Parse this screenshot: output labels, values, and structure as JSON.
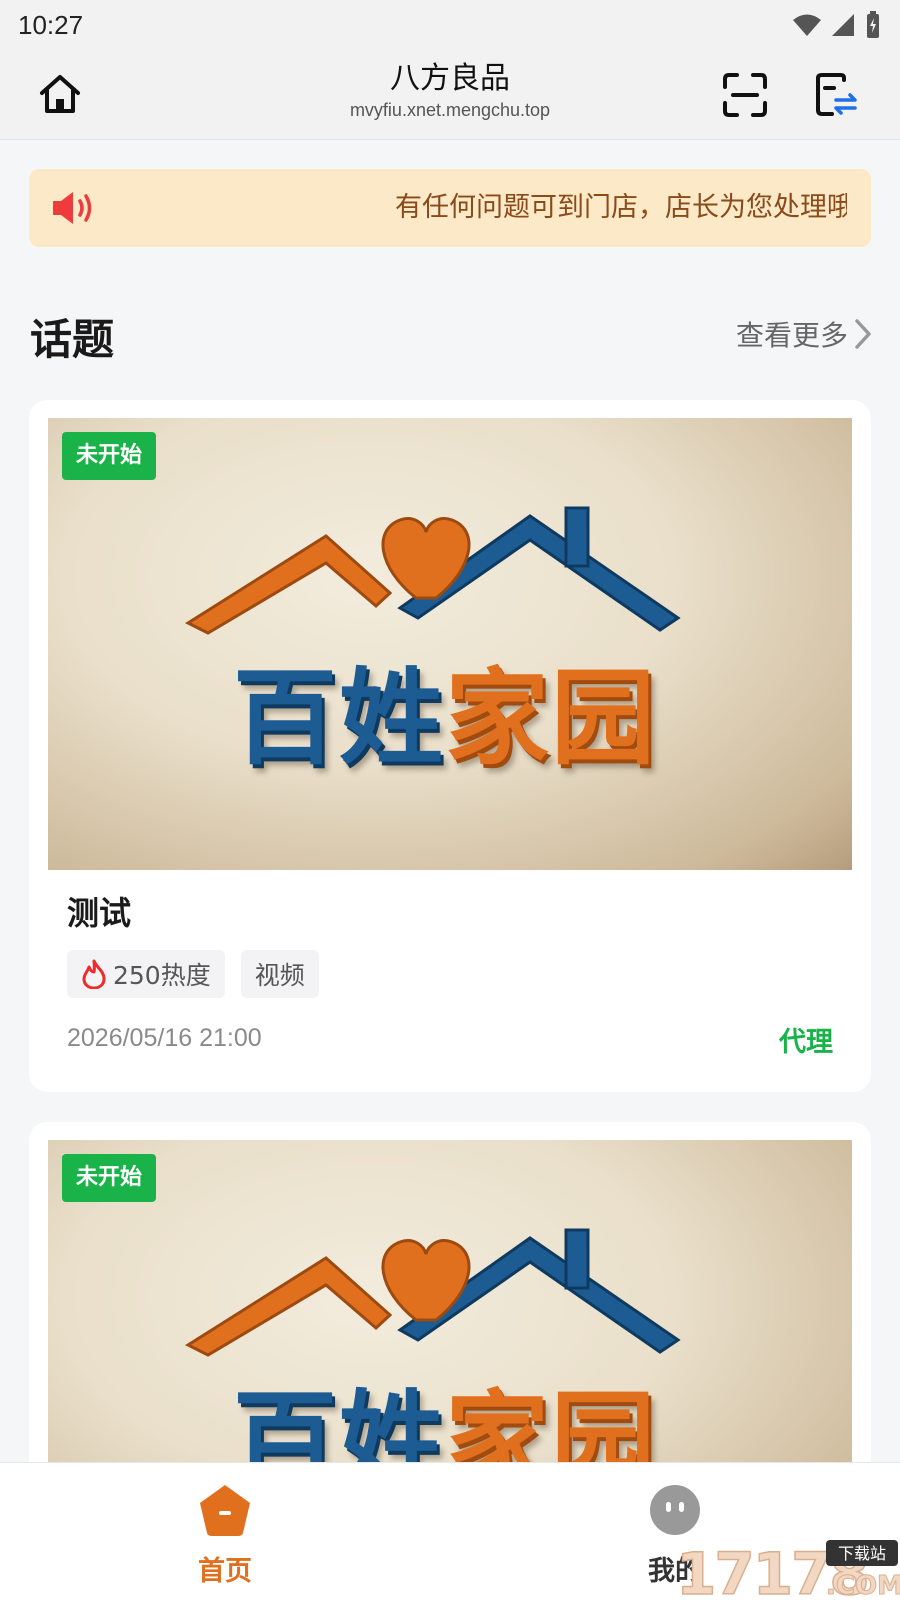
{
  "status_bar": {
    "time": "10:27"
  },
  "browser": {
    "title": "八方良品",
    "url": "mvyfiu.xnet.mengchu.top"
  },
  "notice": {
    "text": "有任何问题可到门店，店长为您处理哦"
  },
  "section": {
    "title": "话题",
    "see_more": "查看更多"
  },
  "cards": [
    {
      "badge": "未开始",
      "logo": {
        "part1": "百姓",
        "part2": "家",
        "part3": "园"
      },
      "title": "测试",
      "heat": "250热度",
      "tag": "视频",
      "date": "2026/05/16 21:00",
      "action": "代理"
    },
    {
      "badge": "未开始",
      "logo": {
        "part1": "百姓",
        "part2": "家",
        "part3": "园"
      }
    }
  ],
  "bottom_nav": {
    "items": [
      {
        "label": "首页",
        "icon": "home-icon",
        "active": true
      },
      {
        "label": "我的",
        "icon": "profile-icon",
        "active": false
      }
    ]
  },
  "colors": {
    "accent_orange": "#e0701e",
    "badge_green": "#19b34a",
    "logo_blue": "#1d5c93",
    "notice_bg": "#fbe9c8"
  },
  "watermark": {
    "text": "17178",
    "suffix": ".COM",
    "tag": "下载站"
  }
}
